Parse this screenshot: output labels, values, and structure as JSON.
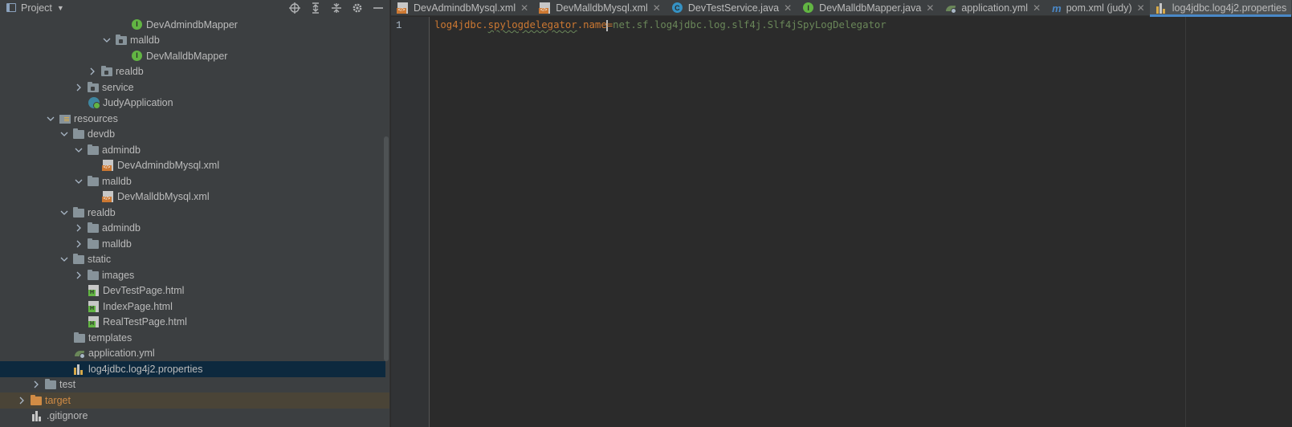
{
  "project_panel": {
    "title": "Project"
  },
  "tree": {
    "devadmindb_mapper": "DevAdmindbMapper",
    "malldb_pkg": "malldb",
    "devmalldb_mapper": "DevMalldbMapper",
    "realdb_pkg": "realdb",
    "service": "service",
    "judy_app": "JudyApplication",
    "resources": "resources",
    "devdb": "devdb",
    "admindb": "admindb",
    "devadmindb_xml": "DevAdmindbMysql.xml",
    "malldb": "malldb",
    "devmalldb_xml": "DevMalldbMysql.xml",
    "realdb": "realdb",
    "realdb_admindb": "admindb",
    "realdb_malldb": "malldb",
    "static": "static",
    "images": "images",
    "devtestpage": "DevTestPage.html",
    "indexpage": "IndexPage.html",
    "realtestpage": "RealTestPage.html",
    "templates": "templates",
    "application_yml": "application.yml",
    "log4jdbc": "log4jdbc.log4j2.properties",
    "test": "test",
    "target": "target",
    "gitignore": ".gitignore"
  },
  "tabs": [
    {
      "label": "DevAdmindbMysql.xml",
      "icon": "xml-file-icon"
    },
    {
      "label": "DevMalldbMysql.xml",
      "icon": "xml-file-icon"
    },
    {
      "label": "DevTestService.java",
      "icon": "class-icon"
    },
    {
      "label": "DevMalldbMapper.java",
      "icon": "interface-icon"
    },
    {
      "label": "application.yml",
      "icon": "spring-yml-icon"
    },
    {
      "label": "pom.xml (judy)",
      "icon": "maven-icon"
    },
    {
      "label": "log4jdbc.log4j2.properties",
      "icon": "properties-icon"
    }
  ],
  "editor": {
    "line_number": "1",
    "key_prefix": "log4jdbc.",
    "key_squiggle": "spylogdelegator",
    "key_suffix": ".name",
    "separator": "=",
    "value": "net.sf.log4jdbc.log.slf4j.Slf4jSpyLogDelegator"
  },
  "colors": {
    "key": "#cc7832",
    "value": "#6a8759",
    "background": "#2b2b2b",
    "panel": "#3c3f41",
    "selection": "#0d293e",
    "accent": "#4a88c7"
  }
}
